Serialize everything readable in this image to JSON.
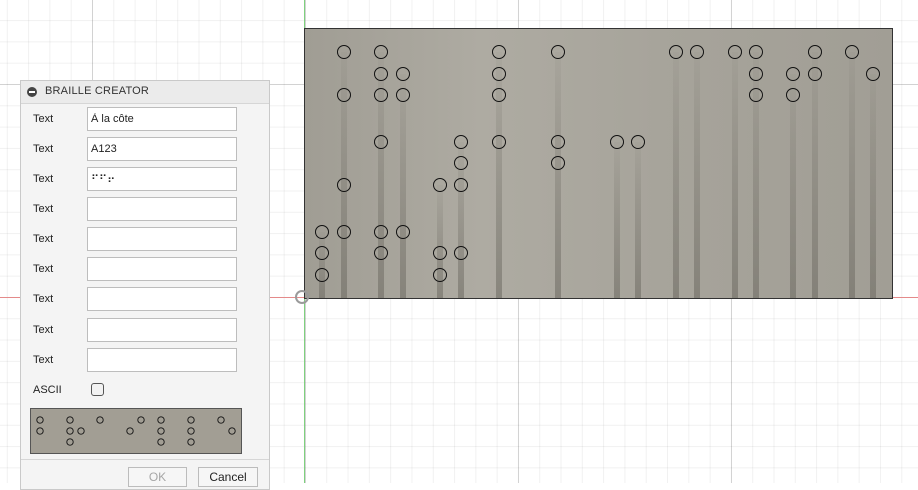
{
  "panel": {
    "title": "BRAILLE CREATOR",
    "text_label": "Text",
    "fields": [
      {
        "label": "Text",
        "value": "À la côte"
      },
      {
        "label": "Text",
        "value": "A123"
      },
      {
        "label": "Text",
        "value": "⠋⠋⠖"
      },
      {
        "label": "Text",
        "value": ""
      },
      {
        "label": "Text",
        "value": ""
      },
      {
        "label": "Text",
        "value": ""
      },
      {
        "label": "Text",
        "value": ""
      },
      {
        "label": "Text",
        "value": ""
      },
      {
        "label": "Text",
        "value": ""
      }
    ],
    "ascii_label": "ASCII",
    "ascii_checked": false,
    "ok_label": "OK",
    "cancel_label": "Cancel",
    "ok_enabled": false
  },
  "colors": {
    "plate_fill": "#a8a59c",
    "axis_x": "#e48a8a",
    "axis_y": "#7ed17e",
    "grid": "#e6e6e6",
    "panel_bg": "#f4f4f4"
  },
  "icons": {
    "collapse": "minus-circle-icon",
    "origin": "origin-point-icon",
    "dot": "braille-dot-icon"
  }
}
